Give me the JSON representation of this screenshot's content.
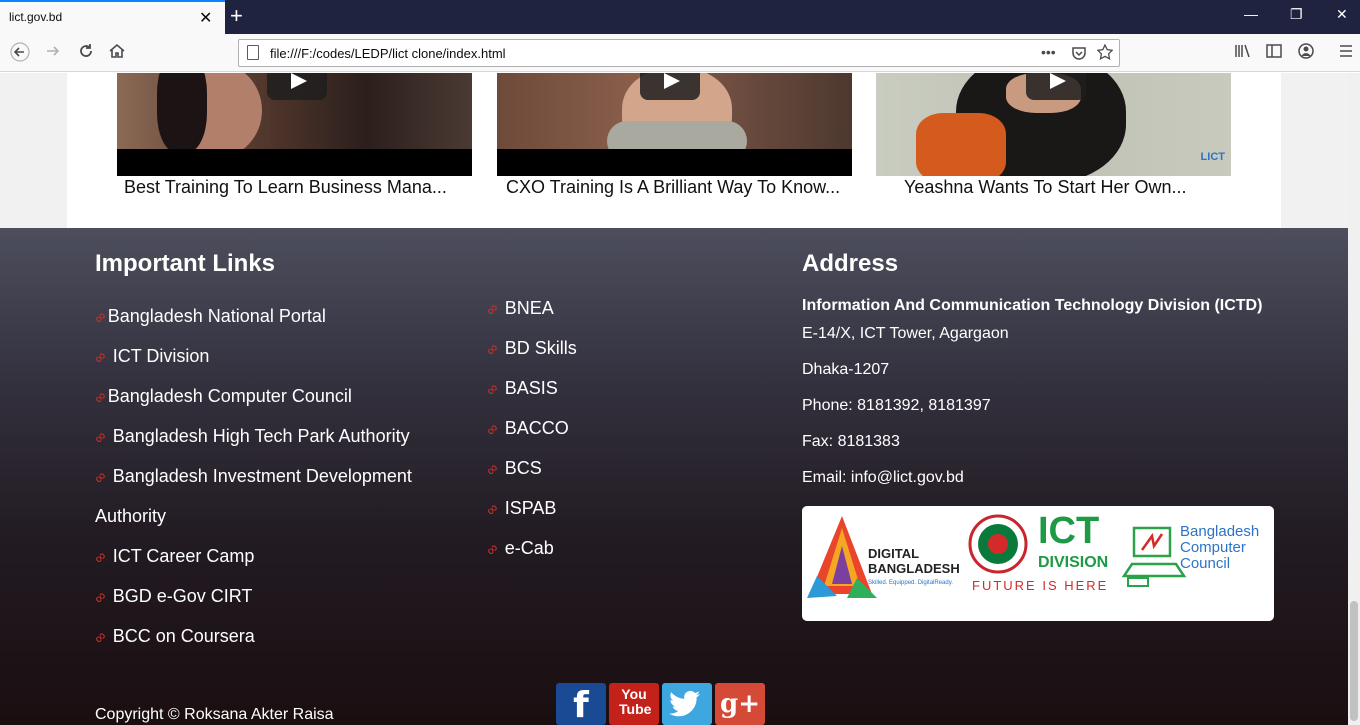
{
  "browser": {
    "tab_title": "lict.gov.bd",
    "tab_close": "✕",
    "new_tab": "+",
    "url": "file:///F:/codes/LEDP/lict clone/index.html",
    "page_actions": "•••",
    "window_controls": [
      "—",
      "❐",
      "✕"
    ]
  },
  "videos": [
    {
      "caption": "Best Training To Learn Business Mana..."
    },
    {
      "caption": "CXO Training Is A Brilliant Way To Know..."
    },
    {
      "caption": "Yeashna Wants To Start Her Own..."
    }
  ],
  "watermark": "LICT",
  "important_links": {
    "title": "Important Links",
    "column1": [
      "Bangladesh National Portal",
      "ICT Division",
      "Bangladesh Computer Council",
      "Bangladesh High Tech Park Authority",
      "Bangladesh Investment Development",
      "Authority",
      "ICT Career Camp",
      "BGD e-Gov CIRT",
      "BCC on Coursera"
    ],
    "column2": [
      "BNEA",
      "BD Skills",
      "BASIS",
      "BACCO",
      "BCS",
      "ISPAB",
      "e-Cab"
    ]
  },
  "address": {
    "title": "Address",
    "org": "Information And Communication Technology Division (ICTD)",
    "line1": "E-14/X, ICT Tower, Agargaon",
    "line2": "Dhaka-1207",
    "phone": "Phone: 8181392, 8181397",
    "fax": "Fax: 8181383",
    "email": "Email: info@lict.gov.bd"
  },
  "logos": {
    "digital_bangladesh": [
      "DIGITAL",
      "BANGLADESH",
      "Skilled. Equipped. DigitalReady."
    ],
    "ict_division": [
      "ICT",
      "DIVISION",
      "FUTURE IS HERE"
    ],
    "bcc": [
      "Bangladesh",
      "Computer",
      "Council"
    ]
  },
  "copyright": "Copyright © Roksana Akter Raisa",
  "social": [
    {
      "name": "facebook",
      "label": "f",
      "color": "#1b4a94"
    },
    {
      "name": "youtube",
      "label": "You Tube",
      "color": "#c4211b"
    },
    {
      "name": "twitter",
      "label": "🐦",
      "color": "#3fa7e0"
    },
    {
      "name": "google-plus",
      "label": "g+",
      "color": "#d44a36"
    }
  ]
}
